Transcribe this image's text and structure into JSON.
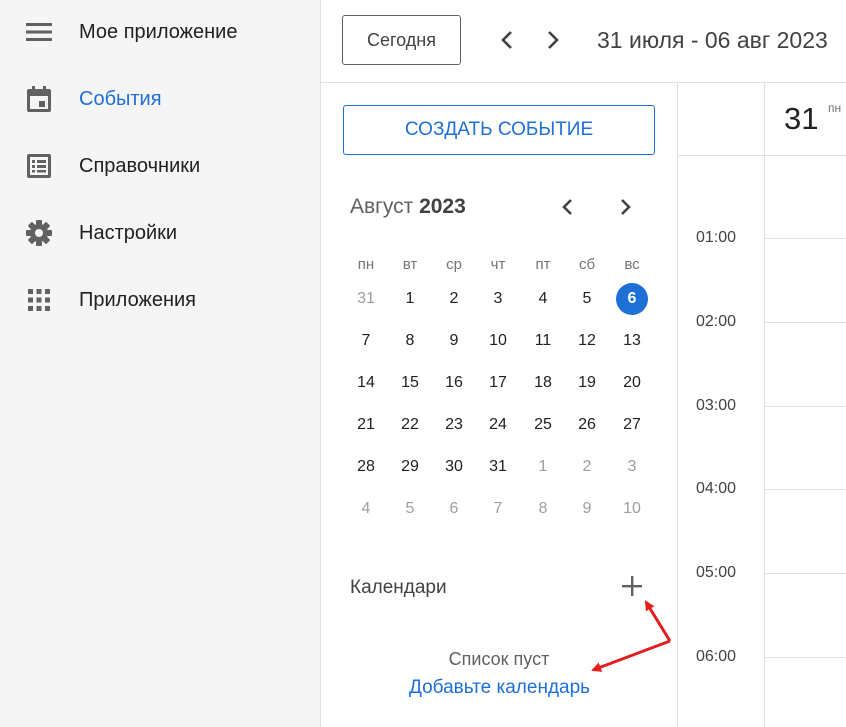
{
  "sidebar": {
    "items": [
      {
        "label": "Мое приложение",
        "icon": "menu-icon"
      },
      {
        "label": "События",
        "icon": "calendar-icon"
      },
      {
        "label": "Справочники",
        "icon": "list-icon"
      },
      {
        "label": "Настройки",
        "icon": "gear-icon"
      },
      {
        "label": "Приложения",
        "icon": "apps-grid-icon"
      }
    ]
  },
  "toolbar": {
    "today_label": "Сегодня",
    "range_title": "31 июля - 06 авг 2023"
  },
  "panel": {
    "create_label": "СОЗДАТЬ СОБЫТИЕ",
    "month_name": "Август",
    "month_year": "2023",
    "weekdays": [
      "пн",
      "вт",
      "ср",
      "чт",
      "пт",
      "сб",
      "вс"
    ],
    "weeks": [
      [
        "31",
        "1",
        "2",
        "3",
        "4",
        "5",
        "6"
      ],
      [
        "7",
        "8",
        "9",
        "10",
        "11",
        "12",
        "13"
      ],
      [
        "14",
        "15",
        "16",
        "17",
        "18",
        "19",
        "20"
      ],
      [
        "21",
        "22",
        "23",
        "24",
        "25",
        "26",
        "27"
      ],
      [
        "28",
        "29",
        "30",
        "31",
        "1",
        "2",
        "3"
      ],
      [
        "4",
        "5",
        "6",
        "7",
        "8",
        "9",
        "10"
      ]
    ],
    "selected_day": "6",
    "calendars_header": "Календари",
    "empty_text": "Список пуст",
    "add_calendar_link": "Добавьте календарь"
  },
  "grid": {
    "day_number": "31",
    "day_abbr": "пн",
    "hours": [
      "01:00",
      "02:00",
      "03:00",
      "04:00",
      "05:00",
      "06:00"
    ]
  },
  "colors": {
    "accent": "#1e6fd6",
    "annotation_arrow": "#e31e1e"
  }
}
